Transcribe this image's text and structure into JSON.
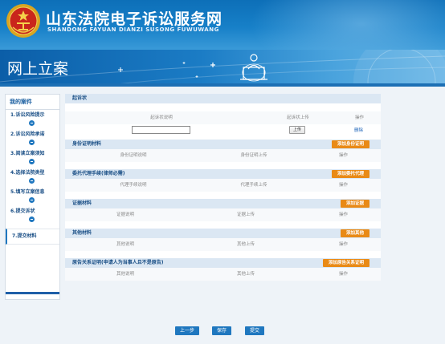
{
  "header": {
    "title": "山东法院电子诉讼服务网",
    "subtitle": "SHANDONG FAYUAN DIANZI SUSONG FUWUWANG"
  },
  "banner": {
    "title": "网上立案"
  },
  "sidebar": {
    "title": "我的案件",
    "items": [
      {
        "label": "1.诉讼风险提示"
      },
      {
        "label": "2.诉讼风险承诺"
      },
      {
        "label": "3.阅读立案须知"
      },
      {
        "label": "4.选择法院类型"
      },
      {
        "label": "5.填写立案信息"
      },
      {
        "label": "6.提交诉状"
      },
      {
        "label": "7.提交材料"
      }
    ]
  },
  "sections": {
    "complaint": {
      "title": "起诉状",
      "cols": [
        "起诉状说明",
        "起诉状上传",
        "操作"
      ],
      "input_value": "",
      "upload_label": "上传",
      "delete_label": "删除"
    },
    "identity": {
      "title": "身份证明材料",
      "add_label": "添加身份证明",
      "cols": [
        "身份证明说明",
        "身份证明上传",
        "操作"
      ]
    },
    "agency": {
      "title": "委托代理手续(律师必需)",
      "add_label": "添加委托代理",
      "cols": [
        "代理手续说明",
        "代理手续上传",
        "操作"
      ]
    },
    "evidence": {
      "title": "证据材料",
      "add_label": "添加证据",
      "cols": [
        "证据说明",
        "证据上传",
        "操作"
      ]
    },
    "other": {
      "title": "其他材料",
      "add_label": "添加其他",
      "cols": [
        "其他说明",
        "其他上传",
        "操作"
      ]
    },
    "relation": {
      "title": "原告关系证明(申请人为当事人且不是原告)",
      "add_label": "添加原告关系证明",
      "cols": [
        "其他说明",
        "其他上传",
        "操作"
      ]
    }
  },
  "actions": {
    "prev": "上一步",
    "save": "保存",
    "submit": "提交"
  }
}
